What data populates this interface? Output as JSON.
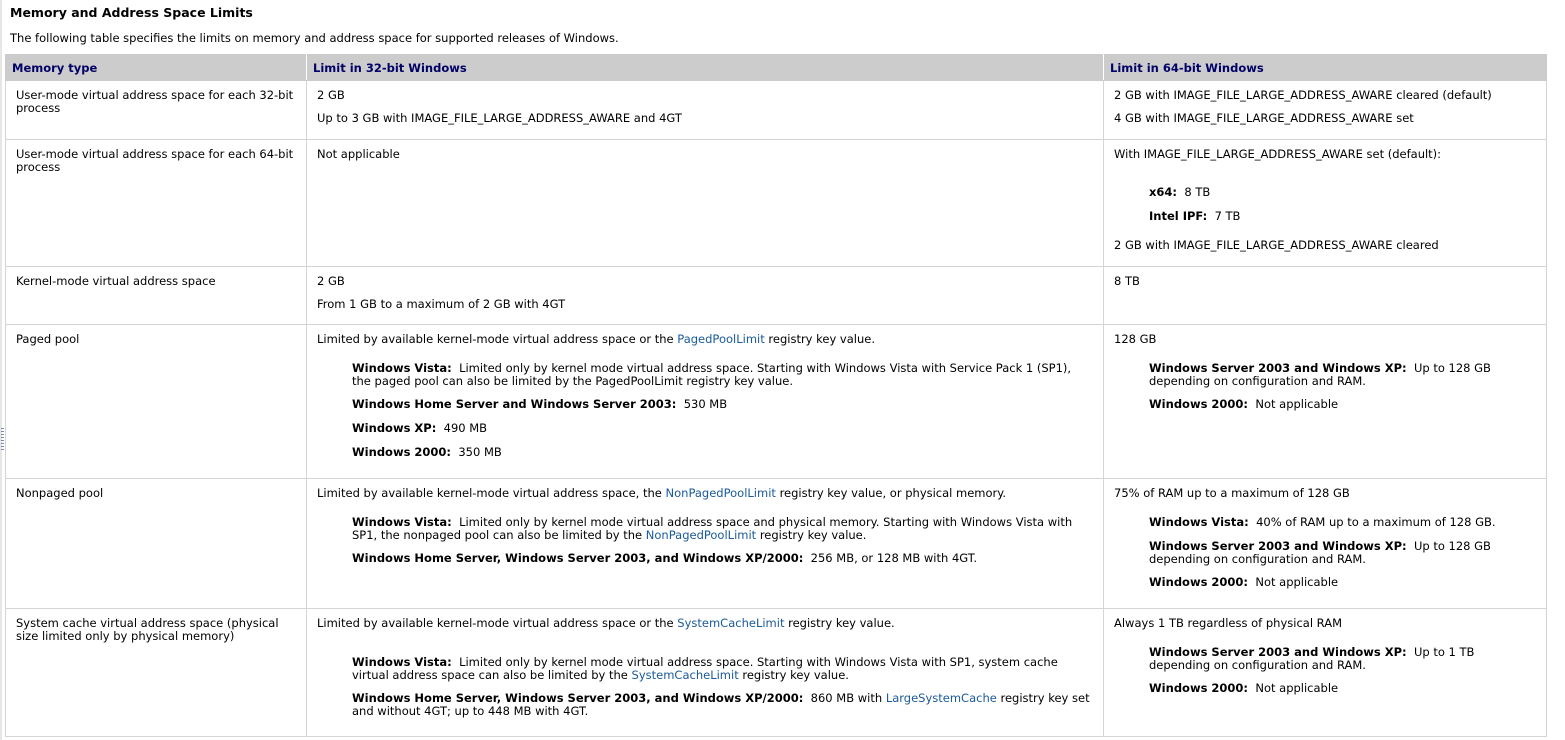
{
  "heading": "Memory and Address Space Limits",
  "intro": "The following table specifies the limits on memory and address space for supported releases of Windows.",
  "table": {
    "headers": [
      "Memory type",
      "Limit in 32-bit Windows",
      "Limit in 64-bit Windows"
    ],
    "rows": [
      {
        "type": "User-mode virtual address space for each 32-bit process",
        "c32": [
          "2 GB",
          "Up to 3 GB with IMAGE_FILE_LARGE_ADDRESS_AWARE and 4GT"
        ],
        "c64": [
          "2 GB with IMAGE_FILE_LARGE_ADDRESS_AWARE cleared (default)",
          "4 GB with IMAGE_FILE_LARGE_ADDRESS_AWARE set"
        ]
      },
      {
        "type": "User-mode virtual address space for each 64-bit process",
        "c32": [
          "Not applicable"
        ],
        "c64": {
          "intro": "With IMAGE_FILE_LARGE_ADDRESS_AWARE set (default):",
          "x64_label": "x64:",
          "x64_value": "8 TB",
          "ipf_label": "Intel IPF:",
          "ipf_value": "7 TB",
          "outro": "2 GB with IMAGE_FILE_LARGE_ADDRESS_AWARE cleared"
        }
      },
      {
        "type": "Kernel-mode virtual address space",
        "c32": [
          "2 GB",
          "From 1 GB to a maximum of 2 GB with 4GT"
        ],
        "c64": [
          "8 TB"
        ]
      },
      {
        "type": "Paged pool",
        "c32": {
          "lead_before": "Limited by available kernel-mode virtual address space or the",
          "lead_link": "PagedPoolLimit",
          "lead_after": "registry key value.",
          "vista_label": "Windows Vista:",
          "vista_text": "Limited only by kernel mode virtual address space. Starting with Windows Vista with Service Pack 1 (SP1), the paged pool can also be limited by the PagedPoolLimit registry key value.",
          "hs_label": "Windows Home Server and Windows Server 2003:",
          "hs_value": "530 MB",
          "xp_label": "Windows XP:",
          "xp_value": "490 MB",
          "w2k_label": "Windows 2000:",
          "w2k_value": "350 MB"
        },
        "c64": {
          "lead": "128 GB",
          "s03_label": "Windows Server 2003 and Windows XP:",
          "s03_text": "Up to 128 GB depending on configuration and RAM.",
          "w2k_label": "Windows 2000:",
          "w2k_value": "Not applicable"
        }
      },
      {
        "type": "Nonpaged pool",
        "c32": {
          "lead_before": "Limited by available kernel-mode virtual address space, the",
          "lead_link": "NonPagedPoolLimit",
          "lead_after": "registry key value, or physical memory.",
          "vista_label": "Windows Vista:",
          "vista_before": "Limited only by kernel mode virtual address space and physical memory. Starting with Windows Vista with SP1, the nonpaged pool can also be limited by the",
          "vista_link": "NonPagedPoolLimit",
          "vista_after": "registry key value.",
          "hs_label": "Windows Home Server, Windows Server 2003, and Windows XP/2000:",
          "hs_value": "256 MB, or 128 MB with 4GT."
        },
        "c64": {
          "lead": "75% of RAM up to a maximum of 128 GB",
          "vista_label": "Windows Vista:",
          "vista_value": "40% of RAM up to a maximum of 128 GB.",
          "s03_label": "Windows Server 2003 and Windows XP:",
          "s03_text": "Up to 128 GB depending on configuration and RAM.",
          "w2k_label": "Windows 2000:",
          "w2k_value": "Not applicable"
        }
      },
      {
        "type": "System cache virtual address space (physical size limited only by physical memory)",
        "c32": {
          "lead_before": "Limited by available kernel-mode virtual address space or the",
          "lead_link": "SystemCacheLimit",
          "lead_after": "registry key value.",
          "vista_label": "Windows Vista:",
          "vista_before": "Limited only by kernel mode virtual address space. Starting with Windows Vista with SP1, system cache virtual address space can also be limited by the",
          "vista_link": "SystemCacheLimit",
          "vista_after": "registry key value.",
          "hs_label": "Windows Home Server, Windows Server 2003, and Windows XP/2000:",
          "hs_before": "860 MB with",
          "hs_link": "LargeSystemCache",
          "hs_after": "registry key set and without 4GT; up to 448 MB with 4GT."
        },
        "c64": {
          "lead": "Always 1 TB regardless of physical RAM",
          "s03_label": "Windows Server 2003 and Windows XP:",
          "s03_text": "Up to 1 TB depending on configuration and RAM.",
          "w2k_label": "Windows 2000:",
          "w2k_value": "Not applicable"
        }
      }
    ]
  },
  "colors": {
    "header_bg": "#cccccc",
    "header_text": "#000066",
    "link": "#1a5a9a",
    "border": "#d4d4d4"
  }
}
